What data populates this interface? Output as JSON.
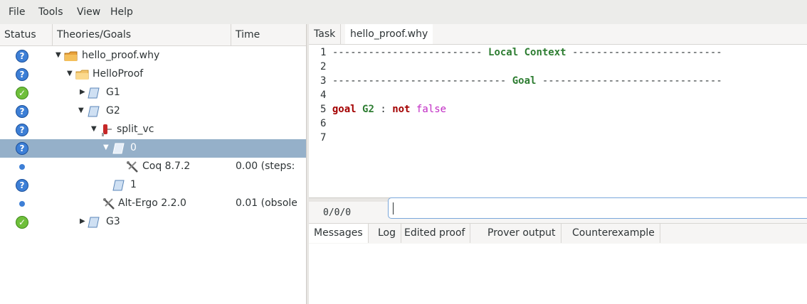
{
  "menu": [
    "File",
    "Tools",
    "View",
    "Help"
  ],
  "tree": {
    "columns": [
      "Status",
      "Theories/Goals",
      "Time"
    ],
    "rows": [
      {
        "status": "unknown",
        "label": "hello_proof.why",
        "time": "",
        "arrow": "down",
        "icon": "file-folder-icon"
      },
      {
        "status": "unknown",
        "label": "HelloProof",
        "time": "",
        "arrow": "down",
        "icon": "theory-folder-icon"
      },
      {
        "status": "valid",
        "label": "G1",
        "time": "",
        "arrow": "right",
        "icon": "goal-scroll-icon"
      },
      {
        "status": "unknown",
        "label": "G2",
        "time": "",
        "arrow": "down",
        "icon": "goal-scroll-icon"
      },
      {
        "status": "unknown",
        "label": "split_vc",
        "time": "",
        "arrow": "down",
        "icon": "transformation-icon"
      },
      {
        "status": "unknown",
        "label": "0",
        "time": "",
        "arrow": "down",
        "icon": "goal-scroll-icon",
        "selected": true
      },
      {
        "status": "dot",
        "label": "Coq 8.7.2",
        "time": "0.00 (steps:",
        "arrow": "",
        "icon": "prover-tool-icon"
      },
      {
        "status": "unknown",
        "label": "1",
        "time": "",
        "arrow": "",
        "icon": "goal-scroll-icon"
      },
      {
        "status": "dot",
        "label": "Alt-Ergo 2.2.0",
        "time": "0.01 (obsole",
        "arrow": "",
        "icon": "prover-tool-icon"
      },
      {
        "status": "valid",
        "label": "G3",
        "time": "",
        "arrow": "right",
        "icon": "goal-scroll-icon"
      }
    ]
  },
  "editor_tabs": [
    "Task",
    "hello_proof.why"
  ],
  "task": {
    "line1": {
      "num": "1",
      "dashes_left": " ------------------------- ",
      "title": "Local Context",
      "dashes_right": " -------------------------"
    },
    "line2": {
      "num": "2"
    },
    "line3": {
      "num": "3",
      "dashes_left": " ----------------------------- ",
      "title": "Goal",
      "dashes_right": " ------------------------------"
    },
    "line4": {
      "num": "4"
    },
    "line5": {
      "num": "5",
      "kw1": "goal",
      "id": "G2",
      "colon": " : ",
      "kw2": "not",
      "val": "false"
    },
    "line6": {
      "num": "6"
    },
    "line7": {
      "num": "7"
    }
  },
  "command": {
    "counter": "0/0/0",
    "value": ""
  },
  "bottom_tabs": [
    "Messages",
    "Log",
    "Edited proof",
    "Prover output",
    "Counterexample"
  ]
}
